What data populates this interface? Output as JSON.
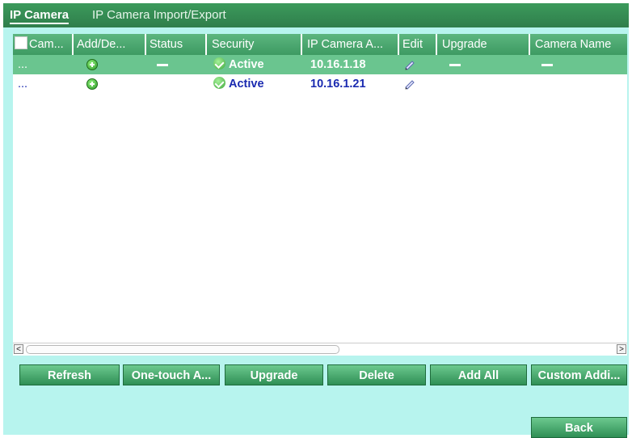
{
  "tabs": {
    "ip_camera": "IP Camera",
    "import_export": "IP Camera Import/Export"
  },
  "table": {
    "columns": [
      "Cam...",
      "Add/De...",
      "Status",
      "Security",
      "IP Camera A...",
      "Edit",
      "Upgrade",
      "Camera Name"
    ],
    "rows": [
      {
        "camera": "...",
        "add_icon": "add-icon",
        "status": "—",
        "security": "Active",
        "ip": "10.16.1.18",
        "edit_icon": "edit-icon",
        "upgrade": "—",
        "camera_name": "—",
        "selected": true
      },
      {
        "camera": "...",
        "add_icon": "add-icon",
        "status": "",
        "security": "Active",
        "ip": "10.16.1.21",
        "edit_icon": "edit-icon",
        "upgrade": "",
        "camera_name": "",
        "selected": false
      }
    ]
  },
  "scrollbar": {
    "left_arrow": "<",
    "right_arrow": ">"
  },
  "buttons": {
    "refresh": "Refresh",
    "one_touch": "One-touch A...",
    "upgrade": "Upgrade",
    "delete": "Delete",
    "add_all": "Add All",
    "custom_adding": "Custom Addi...",
    "back": "Back"
  },
  "colors": {
    "header_green": "#3c9a5c",
    "selected_row": "#6ac58f",
    "panel_bg": "#b7f4ee",
    "link_blue": "#1a2ab0"
  }
}
